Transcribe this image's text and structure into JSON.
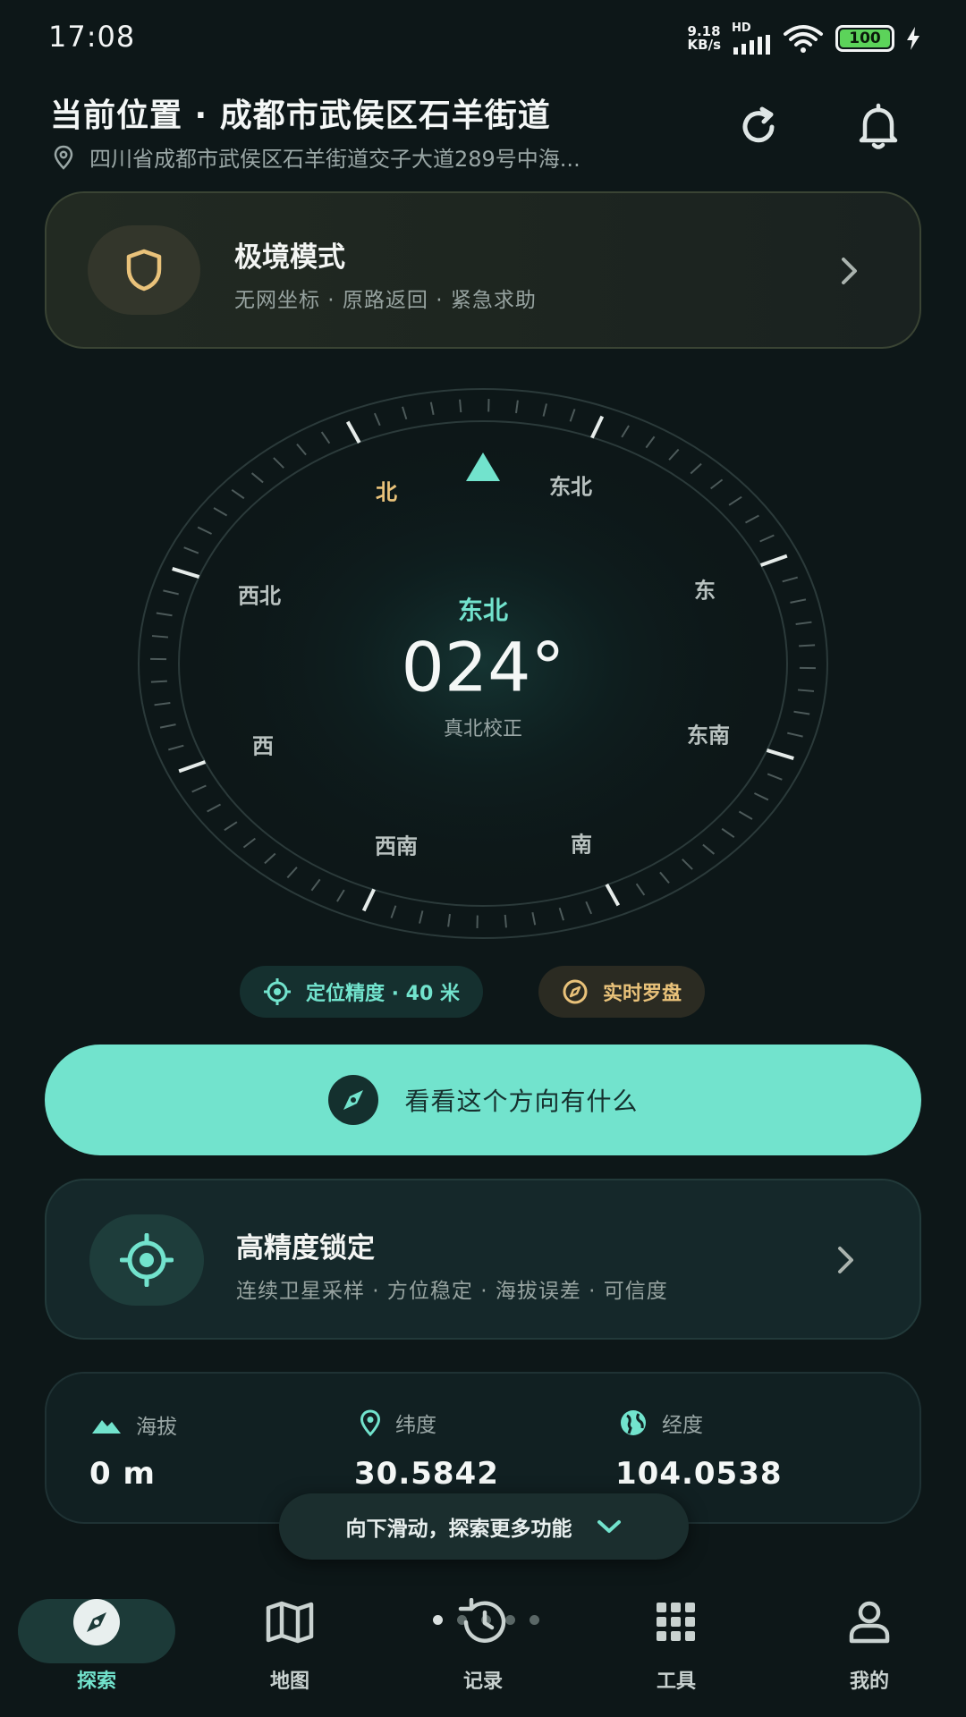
{
  "status_bar": {
    "time": "17:08",
    "net_speed_value": "9.18",
    "net_speed_unit": "KB/s",
    "hd": "HD",
    "battery": "100"
  },
  "header": {
    "title": "当前位置 · 成都市武侯区石羊街道",
    "address": "四川省成都市武侯区石羊街道交子大道289号中海..."
  },
  "extreme_mode": {
    "title": "极境模式",
    "subtitle": "无网坐标 · 原路返回 · 紧急求助"
  },
  "compass": {
    "heading_label": "东北",
    "heading_value": "024°",
    "correction": "真北校正",
    "heading_deg": 24,
    "directions": {
      "n": "北",
      "ne": "东北",
      "e": "东",
      "se": "东南",
      "s": "南",
      "sw": "西南",
      "w": "西",
      "nw": "西北"
    }
  },
  "chips": {
    "accuracy": "定位精度 · 40 米",
    "live_compass": "实时罗盘"
  },
  "explore_button": "看看这个方向有什么",
  "precision_lock": {
    "title": "高精度锁定",
    "subtitle": "连续卫星采样 · 方位稳定 · 海拔误差 · 可信度"
  },
  "stats": {
    "altitude_label": "海拔",
    "altitude_value": "0 m",
    "latitude_label": "纬度",
    "latitude_value": "30.5842",
    "longitude_label": "经度",
    "longitude_value": "104.0538"
  },
  "scroll_hint": "向下滑动，探索更多功能",
  "nav": {
    "explore": "探索",
    "map": "地图",
    "records": "记录",
    "tools": "工具",
    "profile": "我的"
  },
  "colors": {
    "accent": "#72e3cd",
    "warm": "#e9c27a",
    "background": "#0d1718"
  }
}
